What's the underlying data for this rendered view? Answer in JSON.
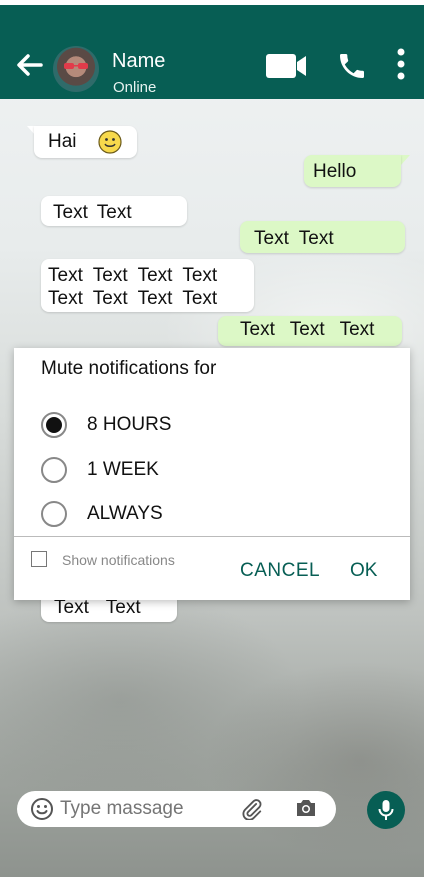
{
  "header": {
    "name": "Name",
    "status": "Online",
    "color": "#075e54",
    "icons": [
      "back-arrow-icon",
      "avatar",
      "video-call-icon",
      "phone-icon",
      "more-vert-icon"
    ]
  },
  "messages": {
    "m1": "Hai",
    "m2": "Hello",
    "m3": "Text Text",
    "m4": "Text Text",
    "m5_line1": "Text Text Text Text",
    "m5_line2": "Text Text Text Text",
    "m6": "Text Text Text",
    "m7": "Text Text"
  },
  "dialog": {
    "title": "Mute notifications for",
    "options": [
      {
        "label": "8 HOURS",
        "selected": true
      },
      {
        "label": "1 WEEK",
        "selected": false
      },
      {
        "label": "ALWAYS",
        "selected": false
      }
    ],
    "show_notifications_label": "Show notifications",
    "show_notifications_checked": false,
    "cancel_label": "CANCEL",
    "ok_label": "OK"
  },
  "input": {
    "placeholder": "Type massage",
    "icons": [
      "emoji-icon",
      "attach-icon",
      "camera-icon",
      "mic-icon"
    ]
  },
  "colors": {
    "outgoing_bubble": "#dcf8c6",
    "incoming_bubble": "#ffffff",
    "accent": "#075e54"
  }
}
